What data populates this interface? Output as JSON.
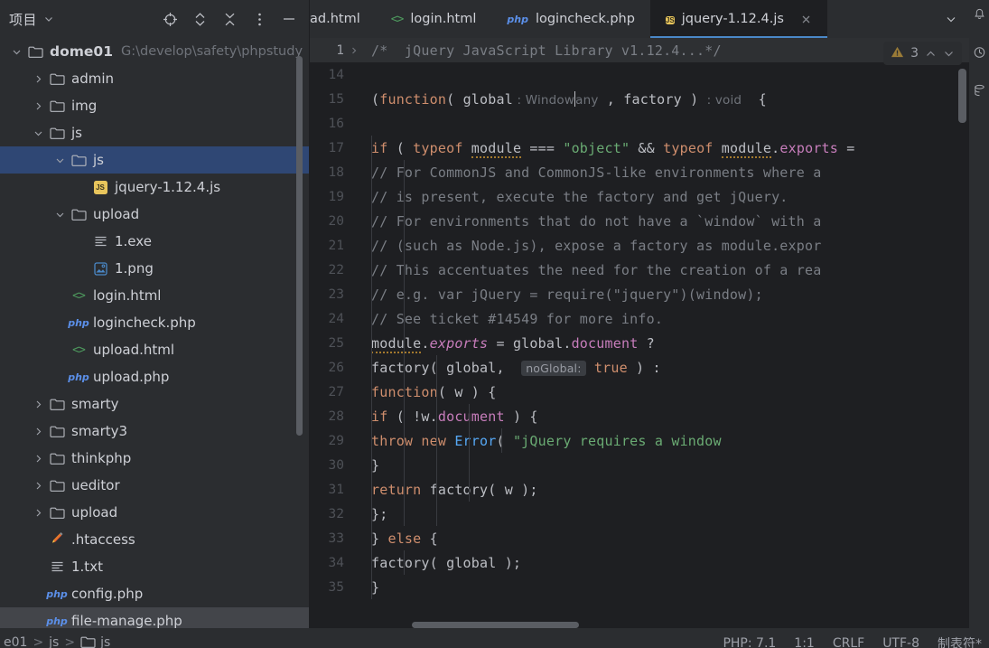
{
  "sidebar": {
    "title": "项目",
    "tools": [
      {
        "name": "locate-icon",
        "label": "Select Opened File"
      },
      {
        "name": "expand-all-icon",
        "label": "Expand All"
      },
      {
        "name": "collapse-all-icon",
        "label": "Collapse All"
      },
      {
        "name": "options-menu-icon",
        "label": "Options"
      },
      {
        "name": "hide-panel-icon",
        "label": "Hide"
      }
    ],
    "tree": [
      {
        "label": "dome01",
        "path": "G:\\develop\\safety\\phpstudy",
        "icon": "folder",
        "indent": 0,
        "arrow": "down",
        "bold": true,
        "selected": false
      },
      {
        "label": "admin",
        "path": "",
        "icon": "folder",
        "indent": 1,
        "arrow": "right",
        "bold": false,
        "selected": false
      },
      {
        "label": "img",
        "path": "",
        "icon": "folder",
        "indent": 1,
        "arrow": "right",
        "bold": false,
        "selected": false
      },
      {
        "label": "js",
        "path": "",
        "icon": "folder",
        "indent": 1,
        "arrow": "down",
        "bold": false,
        "selected": false
      },
      {
        "label": "js",
        "path": "",
        "icon": "folder",
        "indent": 2,
        "arrow": "down",
        "bold": false,
        "selected": true
      },
      {
        "label": "jquery-1.12.4.js",
        "path": "",
        "icon": "js",
        "indent": 3,
        "arrow": "none",
        "bold": false,
        "selected": false
      },
      {
        "label": "upload",
        "path": "",
        "icon": "folder",
        "indent": 2,
        "arrow": "down",
        "bold": false,
        "selected": false
      },
      {
        "label": "1.exe",
        "path": "",
        "icon": "txt",
        "indent": 3,
        "arrow": "none",
        "bold": false,
        "selected": false
      },
      {
        "label": "1.png",
        "path": "",
        "icon": "png",
        "indent": 3,
        "arrow": "none",
        "bold": false,
        "selected": false
      },
      {
        "label": "login.html",
        "path": "",
        "icon": "html",
        "indent": 2,
        "arrow": "none",
        "bold": false,
        "selected": false
      },
      {
        "label": "logincheck.php",
        "path": "",
        "icon": "php",
        "indent": 2,
        "arrow": "none",
        "bold": false,
        "selected": false
      },
      {
        "label": "upload.html",
        "path": "",
        "icon": "html",
        "indent": 2,
        "arrow": "none",
        "bold": false,
        "selected": false
      },
      {
        "label": "upload.php",
        "path": "",
        "icon": "php",
        "indent": 2,
        "arrow": "none",
        "bold": false,
        "selected": false
      },
      {
        "label": "smarty",
        "path": "",
        "icon": "folder",
        "indent": 1,
        "arrow": "right",
        "bold": false,
        "selected": false
      },
      {
        "label": "smarty3",
        "path": "",
        "icon": "folder",
        "indent": 1,
        "arrow": "right",
        "bold": false,
        "selected": false
      },
      {
        "label": "thinkphp",
        "path": "",
        "icon": "folder",
        "indent": 1,
        "arrow": "right",
        "bold": false,
        "selected": false
      },
      {
        "label": "ueditor",
        "path": "",
        "icon": "folder",
        "indent": 1,
        "arrow": "right",
        "bold": false,
        "selected": false
      },
      {
        "label": "upload",
        "path": "",
        "icon": "folder",
        "indent": 1,
        "arrow": "right",
        "bold": false,
        "selected": false
      },
      {
        "label": ".htaccess",
        "path": "",
        "icon": "htaccess",
        "indent": 1,
        "arrow": "none",
        "bold": false,
        "selected": false
      },
      {
        "label": "1.txt",
        "path": "",
        "icon": "txt",
        "indent": 1,
        "arrow": "none",
        "bold": false,
        "selected": false
      },
      {
        "label": "config.php",
        "path": "",
        "icon": "php",
        "indent": 1,
        "arrow": "none",
        "bold": false,
        "selected": false
      },
      {
        "label": "file-manage.php",
        "path": "",
        "icon": "php",
        "indent": 1,
        "arrow": "none",
        "bold": false,
        "selected": false
      }
    ]
  },
  "tabs": [
    {
      "label": "ad.html",
      "icon": "none",
      "active": false,
      "partial": true,
      "closable": false
    },
    {
      "label": "login.html",
      "icon": "html",
      "active": false,
      "closable": false
    },
    {
      "label": "logincheck.php",
      "icon": "php",
      "active": false,
      "closable": false
    },
    {
      "label": "jquery-1.12.4.js",
      "icon": "js",
      "active": true,
      "closable": true
    }
  ],
  "tabbar_actions": [
    {
      "name": "tab-list-chevron-icon",
      "label": "Show tab list"
    },
    {
      "name": "tab-options-icon",
      "label": "Tab options"
    }
  ],
  "editor": {
    "warning": {
      "count": "3",
      "icon": "warning-triangle-icon"
    },
    "lines": [
      {
        "num": "1",
        "folded": true,
        "fold_arrow": true,
        "indent": 0,
        "tokens": [
          {
            "t": "/*  jQuery JavaScript Library v1.12.4...*/",
            "c": "com"
          }
        ]
      },
      {
        "num": "14",
        "indent": 0,
        "tokens": []
      },
      {
        "num": "15",
        "indent": 0,
        "tokens": [
          {
            "t": "(",
            "c": "id"
          },
          {
            "t": "function",
            "c": "kw"
          },
          {
            "t": "( ",
            "c": "id"
          },
          {
            "t": "global",
            "c": "id"
          },
          {
            "t": " : ",
            "c": "hint"
          },
          {
            "t": "Window",
            "c": "hint"
          },
          {
            "t": "|",
            "c": "caret"
          },
          {
            "t": "any",
            "c": "hint"
          },
          {
            "t": " , ",
            "c": "id"
          },
          {
            "t": "factory",
            "c": "id"
          },
          {
            "t": " ) ",
            "c": "id"
          },
          {
            "t": ": ",
            "c": "hint"
          },
          {
            "t": "void",
            "c": "hint"
          },
          {
            "t": "  {",
            "c": "id"
          }
        ]
      },
      {
        "num": "16",
        "indent": 0,
        "tokens": []
      },
      {
        "num": "17",
        "indent": 1,
        "tokens": [
          {
            "t": "if",
            "c": "kw"
          },
          {
            "t": " ( ",
            "c": "id"
          },
          {
            "t": "typeof",
            "c": "kw"
          },
          {
            "t": " ",
            "c": "id"
          },
          {
            "t": "module",
            "c": "warnu"
          },
          {
            "t": " === ",
            "c": "id"
          },
          {
            "t": "\"object\"",
            "c": "str"
          },
          {
            "t": " && ",
            "c": "id"
          },
          {
            "t": "typeof",
            "c": "kw"
          },
          {
            "t": " ",
            "c": "id"
          },
          {
            "t": "module",
            "c": "warnu"
          },
          {
            "t": ".",
            "c": "id"
          },
          {
            "t": "exports",
            "c": "prop"
          },
          {
            "t": " =",
            "c": "id"
          }
        ]
      },
      {
        "num": "18",
        "indent": 2,
        "tokens": [
          {
            "t": "// For CommonJS and CommonJS-like environments where a",
            "c": "com"
          }
        ]
      },
      {
        "num": "19",
        "indent": 2,
        "tokens": [
          {
            "t": "// is present, execute the factory and get jQuery.",
            "c": "com"
          }
        ]
      },
      {
        "num": "20",
        "indent": 2,
        "tokens": [
          {
            "t": "// For environments that do not have a `window` with a",
            "c": "com"
          }
        ]
      },
      {
        "num": "21",
        "indent": 2,
        "tokens": [
          {
            "t": "// (such as Node.js), expose a factory as module.expor",
            "c": "com"
          }
        ]
      },
      {
        "num": "22",
        "indent": 2,
        "tokens": [
          {
            "t": "// This accentuates the need for the creation of a rea",
            "c": "com"
          }
        ]
      },
      {
        "num": "23",
        "indent": 2,
        "tokens": [
          {
            "t": "// e.g. var jQuery = require(\"jquery\")(window);",
            "c": "com"
          }
        ]
      },
      {
        "num": "24",
        "indent": 2,
        "tokens": [
          {
            "t": "// See ticket #14549 for more info.",
            "c": "com"
          }
        ]
      },
      {
        "num": "25",
        "indent": 2,
        "tokens": [
          {
            "t": "module",
            "c": "warnu"
          },
          {
            "t": ".",
            "c": "id"
          },
          {
            "t": "exports",
            "c": "fld"
          },
          {
            "t": " = ",
            "c": "id"
          },
          {
            "t": "global",
            "c": "id"
          },
          {
            "t": ".",
            "c": "id"
          },
          {
            "t": "document",
            "c": "prop"
          },
          {
            "t": " ?",
            "c": "id"
          }
        ]
      },
      {
        "num": "26",
        "indent": 3,
        "tokens": [
          {
            "t": "factory",
            "c": "id"
          },
          {
            "t": "( ",
            "c": "id"
          },
          {
            "t": "global",
            "c": "id"
          },
          {
            "t": ",  ",
            "c": "id"
          },
          {
            "t": "noGlobal:",
            "c": "pill"
          },
          {
            "t": " ",
            "c": "id"
          },
          {
            "t": "true",
            "c": "kw"
          },
          {
            "t": " ) :",
            "c": "id"
          }
        ]
      },
      {
        "num": "27",
        "indent": 3,
        "tokens": [
          {
            "t": "function",
            "c": "kw"
          },
          {
            "t": "( w ) {",
            "c": "id"
          }
        ]
      },
      {
        "num": "28",
        "indent": 4,
        "tokens": [
          {
            "t": "if",
            "c": "kw"
          },
          {
            "t": " ( !w.",
            "c": "id"
          },
          {
            "t": "document",
            "c": "prop"
          },
          {
            "t": " ) {",
            "c": "id"
          }
        ]
      },
      {
        "num": "29",
        "indent": 5,
        "tokens": [
          {
            "t": "throw",
            "c": "kw"
          },
          {
            "t": " ",
            "c": "id"
          },
          {
            "t": "new",
            "c": "kw"
          },
          {
            "t": " ",
            "c": "id"
          },
          {
            "t": "Error",
            "c": "cls"
          },
          {
            "t": "( ",
            "c": "id"
          },
          {
            "t": "\"jQuery requires a window",
            "c": "str"
          }
        ]
      },
      {
        "num": "30",
        "indent": 4,
        "tokens": [
          {
            "t": "}",
            "c": "id"
          }
        ]
      },
      {
        "num": "31",
        "indent": 4,
        "tokens": [
          {
            "t": "return",
            "c": "kw"
          },
          {
            "t": " factory( w );",
            "c": "id"
          }
        ]
      },
      {
        "num": "32",
        "indent": 3,
        "tokens": [
          {
            "t": "};",
            "c": "id"
          }
        ]
      },
      {
        "num": "33",
        "indent": 1,
        "tokens": [
          {
            "t": "} ",
            "c": "id"
          },
          {
            "t": "else",
            "c": "kw"
          },
          {
            "t": " {",
            "c": "id"
          }
        ]
      },
      {
        "num": "34",
        "indent": 2,
        "tokens": [
          {
            "t": "factory( global );",
            "c": "id"
          }
        ]
      },
      {
        "num": "35",
        "indent": 1,
        "tokens": [
          {
            "t": "}",
            "c": "id"
          }
        ]
      }
    ]
  },
  "rail": [
    {
      "name": "notifications-icon"
    },
    {
      "name": "database-icon"
    },
    {
      "name": "structure-icon"
    }
  ],
  "status": {
    "breadcrumb": [
      {
        "label": "e01",
        "icon": "none"
      },
      {
        "label": "js",
        "icon": "none"
      },
      {
        "label": "js",
        "icon": "folder"
      }
    ],
    "right": [
      {
        "label": "PHP: 7.1",
        "name": "php-version"
      },
      {
        "label": "1:1",
        "name": "caret-position"
      },
      {
        "label": "CRLF",
        "name": "line-separator"
      },
      {
        "label": "UTF-8",
        "name": "file-encoding"
      },
      {
        "label": "制表符*",
        "name": "indent-setting"
      }
    ]
  }
}
